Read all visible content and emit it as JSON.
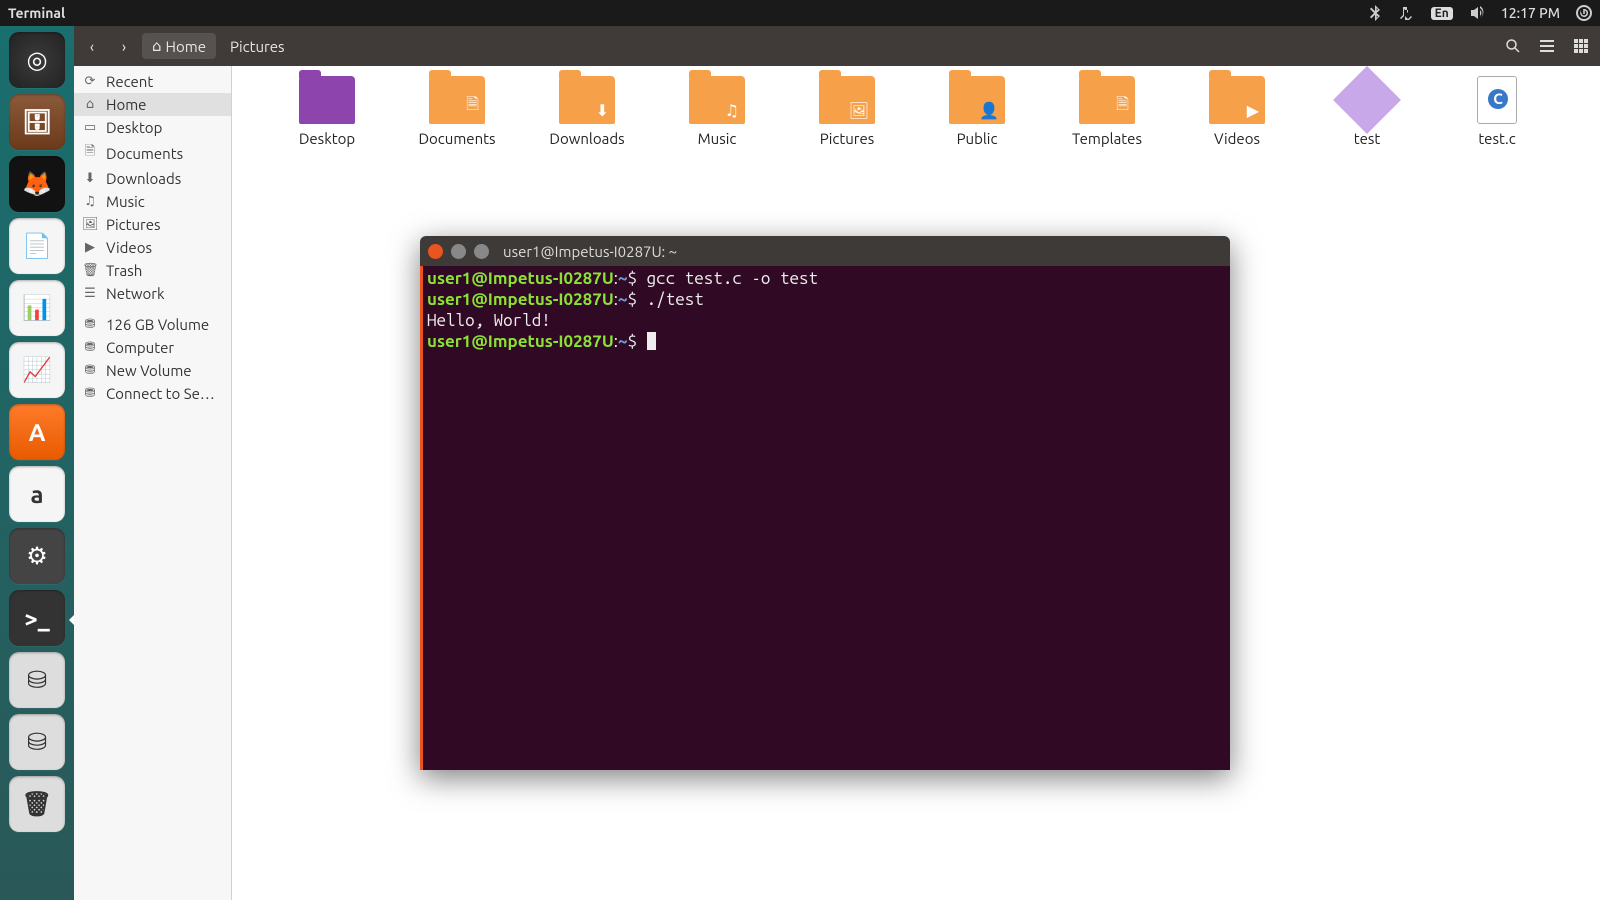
{
  "topbar": {
    "app_name": "Terminal",
    "lang": "En",
    "clock": "12:17 PM"
  },
  "launcher": [
    {
      "name": "dash-icon",
      "cls": "lbg-dash",
      "glyph": "◎"
    },
    {
      "name": "files-icon",
      "cls": "lbg-files",
      "glyph": "🗄"
    },
    {
      "name": "firefox-icon",
      "cls": "lbg-ff",
      "glyph": "🦊"
    },
    {
      "name": "writer-icon",
      "cls": "lbg-white",
      "glyph": "📄"
    },
    {
      "name": "calc-icon",
      "cls": "lbg-green",
      "glyph": "📊"
    },
    {
      "name": "impress-icon",
      "cls": "lbg-white",
      "glyph": "📈"
    },
    {
      "name": "software-icon",
      "cls": "lbg-orange",
      "glyph": "A"
    },
    {
      "name": "amazon-icon",
      "cls": "lbg-az",
      "glyph": "a"
    },
    {
      "name": "settings-icon",
      "cls": "lbg-gear",
      "glyph": "⚙"
    },
    {
      "name": "terminal-icon",
      "cls": "lbg-term",
      "glyph": ">_",
      "active": true
    },
    {
      "name": "drive1-icon",
      "cls": "lbg-drive",
      "glyph": "⛁"
    },
    {
      "name": "drive2-icon",
      "cls": "lbg-drive",
      "glyph": "⛁"
    },
    {
      "name": "trash-icon",
      "cls": "lbg-trash",
      "glyph": "🗑"
    }
  ],
  "breadcrumb": {
    "home": "Home",
    "pictures": "Pictures"
  },
  "places": [
    {
      "icon": "⟳",
      "label": "Recent"
    },
    {
      "icon": "⌂",
      "label": "Home",
      "sel": true
    },
    {
      "icon": "▭",
      "label": "Desktop"
    },
    {
      "icon": "🗎",
      "label": "Documents"
    },
    {
      "icon": "⬇",
      "label": "Downloads"
    },
    {
      "icon": "♫",
      "label": "Music"
    },
    {
      "icon": "🖼",
      "label": "Pictures"
    },
    {
      "icon": "▶",
      "label": "Videos"
    },
    {
      "icon": "🗑",
      "label": "Trash"
    },
    {
      "icon": "☰",
      "label": "Network"
    },
    {
      "icon": "⛃",
      "label": "126 GB Volume"
    },
    {
      "icon": "⛃",
      "label": "Computer"
    },
    {
      "icon": "⛃",
      "label": "New Volume"
    },
    {
      "icon": "⛃",
      "label": "Connect to Se…"
    }
  ],
  "grid": [
    {
      "label": "Desktop",
      "kind": "folder",
      "extra": "desk",
      "emoji": ""
    },
    {
      "label": "Documents",
      "kind": "folder",
      "emoji": "🗎"
    },
    {
      "label": "Downloads",
      "kind": "folder",
      "emoji": "⬇"
    },
    {
      "label": "Music",
      "kind": "folder",
      "emoji": "♫"
    },
    {
      "label": "Pictures",
      "kind": "folder",
      "emoji": "🖼"
    },
    {
      "label": "Public",
      "kind": "folder",
      "emoji": "👤"
    },
    {
      "label": "Templates",
      "kind": "folder",
      "emoji": "🗎"
    },
    {
      "label": "Videos",
      "kind": "folder",
      "emoji": "▶"
    },
    {
      "label": "test",
      "kind": "exe"
    },
    {
      "label": "test.c",
      "kind": "cfile"
    }
  ],
  "terminal": {
    "title": "user1@Impetus-I0287U: ~",
    "prompt_user": "user1@Impetus-I0287U",
    "prompt_path": "~",
    "lines": [
      {
        "type": "cmd",
        "text": "gcc test.c -o test"
      },
      {
        "type": "cmd",
        "text": "./test"
      },
      {
        "type": "out",
        "text": "Hello, World!"
      },
      {
        "type": "prompt"
      }
    ]
  }
}
